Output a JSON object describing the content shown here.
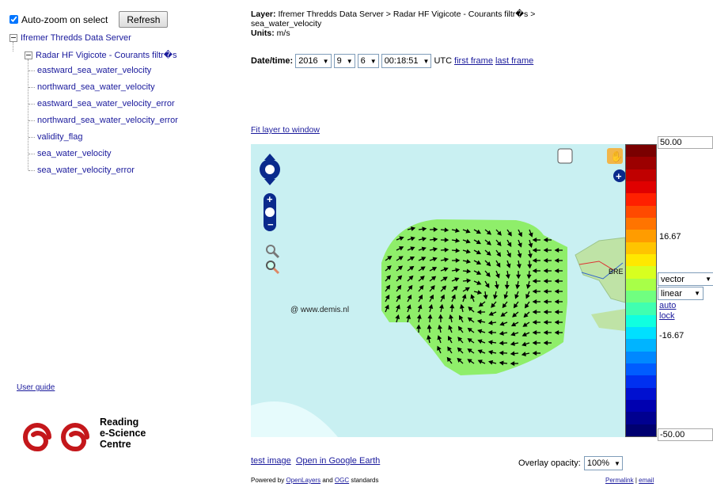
{
  "left": {
    "autozoom_label": "Auto-zoom on select",
    "refresh_label": "Refresh",
    "tree": {
      "root": "Ifremer Thredds Data Server",
      "dataset": "Radar HF Vigicote - Courants filtr�s",
      "variables": [
        "eastward_sea_water_velocity",
        "northward_sea_water_velocity",
        "eastward_sea_water_velocity_error",
        "northward_sea_water_velocity_error",
        "validity_flag",
        "sea_water_velocity",
        "sea_water_velocity_error"
      ]
    },
    "user_guide": "User guide",
    "logo_lines": [
      "Reading",
      "e-Science",
      "Centre"
    ]
  },
  "info": {
    "layer_label": "Layer:",
    "layer_value": "Ifremer Thredds Data Server > Radar HF Vigicote - Courants filtr�s > sea_water_velocity",
    "units_label": "Units:",
    "units_value": "m/s"
  },
  "datetime": {
    "label": "Date/time:",
    "year": "2016",
    "month": "9",
    "day": "6",
    "time": "00:18:51",
    "utc": "UTC",
    "first_frame": "first frame",
    "last_frame": "last frame"
  },
  "fit_layer": "Fit layer to window",
  "map": {
    "watermark": "@ www.demis.nl",
    "city_label": "BRE"
  },
  "colorbar": {
    "max": "50.00",
    "upper_mid": "16.67",
    "lower_mid": "-16.67",
    "min": "-50.00",
    "style": "vector",
    "scale": "linear",
    "auto": "auto",
    "lock": "lock",
    "colors": [
      "#7a0000",
      "#9c0000",
      "#c00000",
      "#e00000",
      "#ff2000",
      "#ff4a00",
      "#ff7400",
      "#ff9c00",
      "#ffc400",
      "#ffe800",
      "#d8ff20",
      "#a8ff48",
      "#70ff80",
      "#40ffb0",
      "#10ffe0",
      "#00e0ff",
      "#00b4ff",
      "#0088ff",
      "#005cff",
      "#0030f0",
      "#0010d0",
      "#0000b0",
      "#000090",
      "#000070"
    ]
  },
  "bottom": {
    "test_image": "test image",
    "google_earth": "Open in Google Earth",
    "opacity_label": "Overlay opacity:",
    "opacity_value": "100%",
    "powered_prefix": "Powered by",
    "openlayers": "OpenLayers",
    "and": "and",
    "ogc": "OGC",
    "standards": "standards",
    "permalink": "Permalink",
    "separator": "|",
    "email": "email"
  }
}
